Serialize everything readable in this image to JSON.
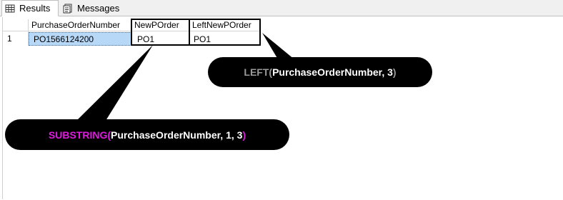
{
  "tabs": [
    {
      "label": "Results",
      "icon": "grid-icon",
      "active": true
    },
    {
      "label": "Messages",
      "icon": "messages-icon",
      "active": false
    }
  ],
  "grid": {
    "columns": [
      "PurchaseOrderNumber",
      "NewPOrder",
      "LeftNewPOrder"
    ],
    "rows": [
      {
        "row_number": "1",
        "cells": [
          "PO1566124200",
          "PO1",
          "PO1"
        ]
      }
    ]
  },
  "callouts": {
    "left": {
      "function": "LEFT",
      "open_paren": "(",
      "args": "PurchaseOrderNumber, 3",
      "close_paren": ")",
      "function_color": "#9a9a9a"
    },
    "substring": {
      "function": "SUBSTRING",
      "open_paren": "(",
      "args": "PurchaseOrderNumber, 1, 3",
      "close_paren": ")",
      "function_color": "#e01ae0"
    }
  },
  "colors": {
    "selected_cell": "#b8d8f8",
    "callout_bg": "#000000"
  }
}
